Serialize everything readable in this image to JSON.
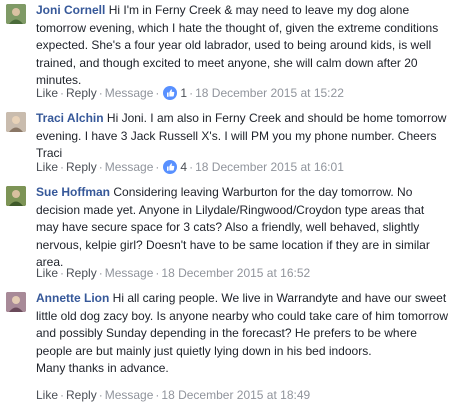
{
  "comments": [
    {
      "author": "Joni Cornell",
      "text": "Hi I'm in Ferny Creek & may need to leave my dog alone tomorrow evening, which I hate the thought of, given the extreme conditions expected. She's a four year old labrador, used to being around kids, is well trained, and though excited to meet anyone, she will calm down after 20 minutes.",
      "like": "Like",
      "reply": "Reply",
      "message": "Message",
      "likes": "1",
      "timestamp": "18 December 2015 at 15:22",
      "avatar_color": "#8aa070"
    },
    {
      "author": "Traci Alchin",
      "text": "Hi Joni. I am also in Ferny Creek and should be home tomorrow evening. I have 3 Jack Russell X's. I will PM you my phone number. Cheers Traci",
      "like": "Like",
      "reply": "Reply",
      "message": "Message",
      "likes": "4",
      "timestamp": "18 December 2015 at 16:01",
      "avatar_color": "#b8a89a"
    },
    {
      "author": "Sue Hoffman",
      "text": "Considering leaving Warburton for the day tomorrow. No decision made yet. Anyone in Lilydale/Ringwood/Croydon type areas that may have secure space for 3 cats? Also a friendly, well behaved, slightly nervous, kelpie girl? Doesn't have to be same location if they are in similar area.",
      "like": "Like",
      "reply": "Reply",
      "message": "Message",
      "timestamp": "18 December 2015 at 16:52",
      "avatar_color": "#6f8a4a"
    },
    {
      "author": "Annette Lion",
      "text": "Hi all caring people. We live in Warrandyte and have our sweet little old dog zacy boy. Is anyone nearby who could take care of him tomorrow and possibly Sunday depending in the forecast? He prefers to be where people are but mainly just quietly lying down in his bed indoors.\nMany thanks in advance.",
      "like": "Like",
      "reply": "Reply",
      "message": "Message",
      "timestamp": "18 December 2015 at 18:49",
      "avatar_color": "#9a7a8a"
    }
  ],
  "separator": "·",
  "colors": {
    "link": "#365899",
    "meta": "#90949c",
    "like_badge": "#5890ff"
  }
}
